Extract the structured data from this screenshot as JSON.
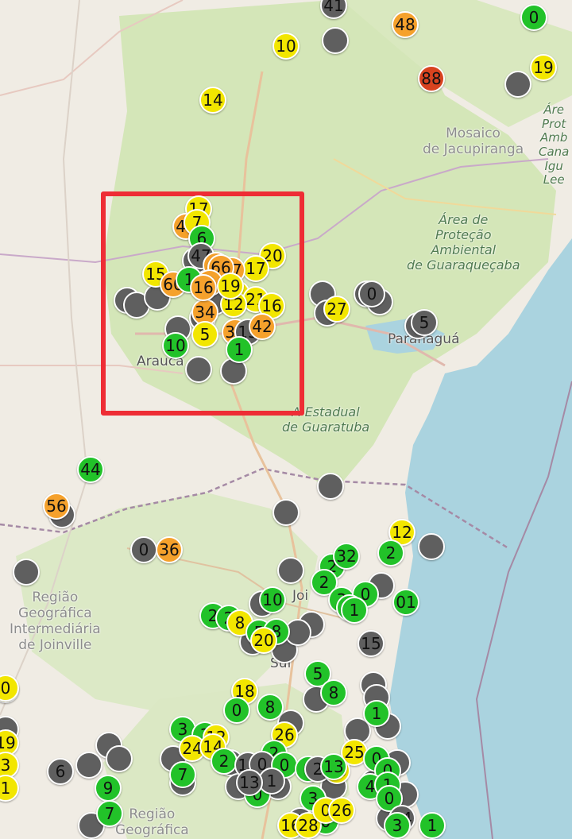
{
  "map": {
    "labels": {
      "mosaico": "Mosaico\nde Jacupiranga",
      "area_prot_right": "Áre\nProt\nAmb\nCana\nIgu\nLee",
      "guaraquecaba": "Área de\nProteção\nAmbiental\nde Guaraqueçaba",
      "paranagua": "Paranaguá",
      "araucaria": "Arauca",
      "guaratuba": "A Estadual\nde Guaratuba",
      "joinville_region": "Região\nGeográfica\nIntermediária\nde Joinville",
      "joinville": "Joi",
      "sul": "Sul",
      "regiao_bottom": "Região\nGeográfica"
    },
    "colors": {
      "green": "#22c229",
      "yellow": "#f2e600",
      "orange": "#f5a12c",
      "red": "#d8431f",
      "gray": "#5f5f5f",
      "selection": "#ee2d35",
      "sea": "#aad3df",
      "forest": "#d4e6b8",
      "land": "#f0ece4"
    }
  },
  "markers": [
    {
      "v": "",
      "c": "gray"
    },
    {
      "v": "",
      "c": "gray"
    },
    {
      "v": "",
      "c": "gray"
    },
    {
      "v": "",
      "c": "gray"
    },
    {
      "v": "",
      "c": "gray"
    },
    {
      "v": "",
      "c": "gray"
    },
    {
      "v": "",
      "c": "gray"
    },
    {
      "v": "",
      "c": "gray"
    },
    {
      "v": "",
      "c": "gray"
    },
    {
      "v": "",
      "c": "gray"
    },
    {
      "v": "",
      "c": "gray"
    },
    {
      "v": "",
      "c": "gray"
    },
    {
      "v": "",
      "c": "gray"
    },
    {
      "v": "",
      "c": "gray"
    },
    {
      "v": "",
      "c": "gray"
    },
    {
      "v": "",
      "c": "gray"
    },
    {
      "v": "",
      "c": "gray"
    },
    {
      "v": "",
      "c": "gray"
    },
    {
      "v": "",
      "c": "gray"
    },
    {
      "v": "",
      "c": "gray"
    },
    {
      "v": "",
      "c": "gray"
    },
    {
      "v": "",
      "c": "gray"
    },
    {
      "v": "",
      "c": "gray"
    },
    {
      "v": "",
      "c": "gray"
    },
    {
      "v": "",
      "c": "gray"
    },
    {
      "v": "",
      "c": "gray"
    },
    {
      "v": "",
      "c": "gray"
    },
    {
      "v": "",
      "c": "gray"
    },
    {
      "v": "",
      "c": "gray"
    },
    {
      "v": "",
      "c": "gray"
    },
    {
      "v": "",
      "c": "gray"
    },
    {
      "v": "",
      "c": "gray"
    },
    {
      "v": "",
      "c": "gray"
    },
    {
      "v": "",
      "c": "gray"
    },
    {
      "v": "",
      "c": "gray"
    },
    {
      "v": "",
      "c": "gray"
    },
    {
      "v": "",
      "c": "gray"
    },
    {
      "v": "",
      "c": "gray"
    },
    {
      "v": "",
      "c": "gray"
    },
    {
      "v": "",
      "c": "gray"
    },
    {
      "v": "",
      "c": "gray"
    },
    {
      "v": "",
      "c": "gray"
    },
    {
      "v": "",
      "c": "gray"
    },
    {
      "v": "",
      "c": "gray"
    },
    {
      "v": "",
      "c": "gray"
    },
    {
      "v": "",
      "c": "gray"
    },
    {
      "v": "",
      "c": "gray"
    },
    {
      "v": "",
      "c": "gray"
    },
    {
      "v": "",
      "c": "gray"
    },
    {
      "v": "41",
      "c": "gray"
    },
    {
      "v": "48",
      "c": "orange"
    },
    {
      "v": "0",
      "c": "green"
    },
    {
      "v": "10",
      "c": "yellow"
    },
    {
      "v": "88",
      "c": "red"
    },
    {
      "v": "19",
      "c": "yellow"
    },
    {
      "v": "14",
      "c": "yellow"
    },
    {
      "v": "17",
      "c": "yellow"
    },
    {
      "v": "47",
      "c": "orange"
    },
    {
      "v": "7",
      "c": "yellow"
    },
    {
      "v": "6",
      "c": "green"
    },
    {
      "v": "47",
      "c": "gray"
    },
    {
      "v": "20",
      "c": "yellow"
    },
    {
      "v": "15",
      "c": "yellow"
    },
    {
      "v": "17",
      "c": "yellow"
    },
    {
      "v": "57",
      "c": "orange"
    },
    {
      "v": "4",
      "c": "orange"
    },
    {
      "v": "34",
      "c": "orange"
    },
    {
      "v": "66",
      "c": "orange"
    },
    {
      "v": "60",
      "c": "orange"
    },
    {
      "v": "1",
      "c": "green"
    },
    {
      "v": "0",
      "c": "orange"
    },
    {
      "v": "16",
      "c": "orange"
    },
    {
      "v": "8",
      "c": "yellow"
    },
    {
      "v": "21",
      "c": "yellow"
    },
    {
      "v": "16",
      "c": "yellow"
    },
    {
      "v": "12",
      "c": "yellow"
    },
    {
      "v": "19",
      "c": "yellow"
    },
    {
      "v": "34",
      "c": "orange"
    },
    {
      "v": "13",
      "c": "gray"
    },
    {
      "v": "5",
      "c": "yellow"
    },
    {
      "v": "42",
      "c": "orange"
    },
    {
      "v": "10",
      "c": "green"
    },
    {
      "v": "1",
      "c": "green"
    },
    {
      "v": "27",
      "c": "yellow"
    },
    {
      "v": "0",
      "c": "gray"
    },
    {
      "v": "5",
      "c": "gray"
    },
    {
      "v": "44",
      "c": "green"
    },
    {
      "v": "56",
      "c": "orange"
    },
    {
      "v": "0",
      "c": "gray"
    },
    {
      "v": "36",
      "c": "orange"
    },
    {
      "v": "12",
      "c": "yellow"
    },
    {
      "v": "2",
      "c": "green"
    },
    {
      "v": "2",
      "c": "green"
    },
    {
      "v": "32",
      "c": "green"
    },
    {
      "v": "2",
      "c": "green"
    },
    {
      "v": "3",
      "c": "green"
    },
    {
      "v": "0",
      "c": "green"
    },
    {
      "v": "1",
      "c": "green"
    },
    {
      "v": "1",
      "c": "green"
    },
    {
      "v": "01",
      "c": "green"
    },
    {
      "v": "10",
      "c": "green"
    },
    {
      "v": "2",
      "c": "green"
    },
    {
      "v": "2",
      "c": "green"
    },
    {
      "v": "8",
      "c": "yellow"
    },
    {
      "v": "5",
      "c": "green"
    },
    {
      "v": "8",
      "c": "green"
    },
    {
      "v": "20",
      "c": "yellow"
    },
    {
      "v": "15",
      "c": "gray"
    },
    {
      "v": "20",
      "c": "yellow"
    },
    {
      "v": "5",
      "c": "green"
    },
    {
      "v": "8",
      "c": "green"
    },
    {
      "v": "18",
      "c": "yellow"
    },
    {
      "v": "0",
      "c": "green"
    },
    {
      "v": "8",
      "c": "green"
    },
    {
      "v": "1",
      "c": "green"
    },
    {
      "v": "3",
      "c": "green"
    },
    {
      "v": "3",
      "c": "green"
    },
    {
      "v": "12",
      "c": "yellow"
    },
    {
      "v": "24",
      "c": "yellow"
    },
    {
      "v": "14",
      "c": "yellow"
    },
    {
      "v": "26",
      "c": "yellow"
    },
    {
      "v": "2",
      "c": "green"
    },
    {
      "v": "2",
      "c": "green"
    },
    {
      "v": "13",
      "c": "gray"
    },
    {
      "v": "0",
      "c": "gray"
    },
    {
      "v": "0",
      "c": "green"
    },
    {
      "v": "0",
      "c": "green"
    },
    {
      "v": "2",
      "c": "gray"
    },
    {
      "v": "25",
      "c": "yellow"
    },
    {
      "v": "20",
      "c": "yellow"
    },
    {
      "v": "0",
      "c": "green"
    },
    {
      "v": "13",
      "c": "green"
    },
    {
      "v": "0",
      "c": "green"
    },
    {
      "v": "4",
      "c": "green"
    },
    {
      "v": "1",
      "c": "green"
    },
    {
      "v": "0",
      "c": "green"
    },
    {
      "v": "1",
      "c": "gray"
    },
    {
      "v": "13",
      "c": "gray"
    },
    {
      "v": "6",
      "c": "gray"
    },
    {
      "v": "7",
      "c": "green"
    },
    {
      "v": "19",
      "c": "yellow"
    },
    {
      "v": "3",
      "c": "yellow"
    },
    {
      "v": "1",
      "c": "yellow"
    },
    {
      "v": "9",
      "c": "green"
    },
    {
      "v": "7",
      "c": "green"
    },
    {
      "v": "3",
      "c": "green"
    },
    {
      "v": "0",
      "c": "green"
    },
    {
      "v": "0",
      "c": "gray"
    },
    {
      "v": "16",
      "c": "yellow"
    },
    {
      "v": "28",
      "c": "yellow"
    },
    {
      "v": "0",
      "c": "yellow"
    },
    {
      "v": "26",
      "c": "yellow"
    },
    {
      "v": "0",
      "c": "green"
    },
    {
      "v": "14",
      "c": "gray"
    },
    {
      "v": "3",
      "c": "green"
    },
    {
      "v": "1",
      "c": "green"
    },
    {
      "v": "0",
      "c": "yellow"
    },
    {
      "v": "5",
      "c": "green"
    }
  ]
}
